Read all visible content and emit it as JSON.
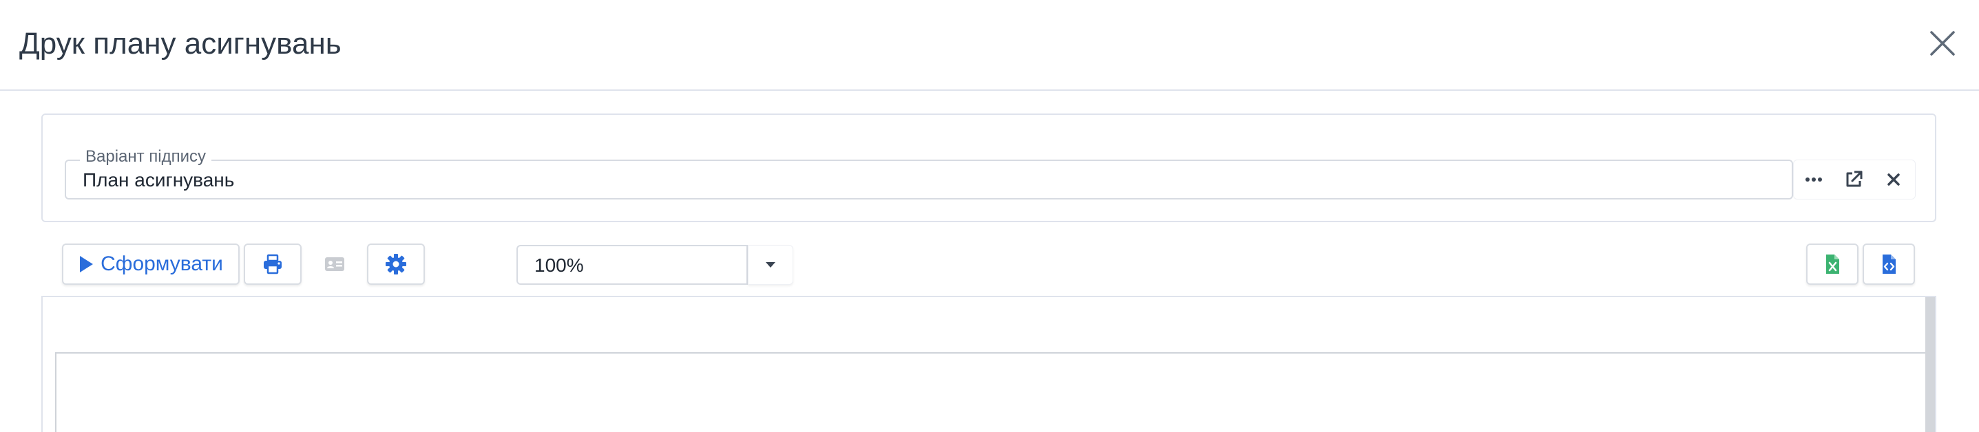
{
  "dialog": {
    "title": "Друк плану асигнувань"
  },
  "signature": {
    "legend": "Варіант підпису",
    "value": "План асигнувань"
  },
  "toolbar": {
    "form_label": "Сформувати",
    "zoom_value": "100%"
  },
  "colors": {
    "accent": "#2a6ddb",
    "excel_green": "#3cb371",
    "border": "#dfe3ec",
    "text": "#2f3a48"
  },
  "icons": {
    "close": "close-icon",
    "ellipsis": "ellipsis-icon",
    "open_external": "external-link-icon",
    "clear": "clear-icon",
    "play": "play-icon",
    "print": "printer-icon",
    "card": "id-card-icon",
    "settings": "gear-icon",
    "dropdown": "caret-down-icon",
    "excel": "excel-file-icon",
    "code": "code-file-icon"
  }
}
